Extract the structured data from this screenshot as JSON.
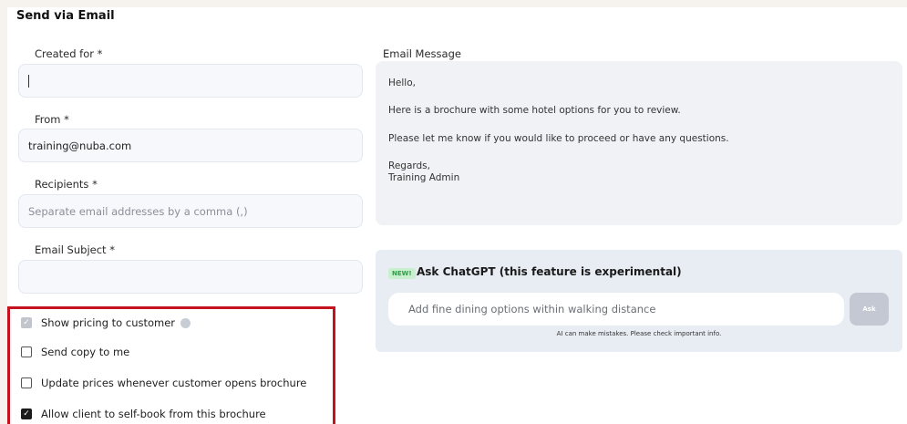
{
  "header": {
    "title": "Send via Email"
  },
  "form": {
    "created_for": {
      "label": "Created for *",
      "value": ""
    },
    "from": {
      "label": "From *",
      "value": "training@nuba.com"
    },
    "recipients": {
      "label": "Recipients *",
      "placeholder": "Separate email addresses by a comma (,)"
    },
    "subject": {
      "label": "Email Subject *",
      "value": ""
    }
  },
  "message": {
    "label": "Email Message",
    "lines": [
      "Hello,",
      "Here is a brochure with some hotel options for you to review.",
      "Please let me know if you would like to proceed or have any questions.",
      "Regards,",
      "Training Admin"
    ]
  },
  "ai": {
    "badge": "NEW!",
    "title": "Ask ChatGPT (this feature is experimental)",
    "input_value": "Add fine dining options within walking distance",
    "ask_label": "Ask",
    "disclaimer": "AI can make mistakes. Please check important info."
  },
  "options": [
    {
      "label": "Show pricing to customer",
      "checked": true,
      "disabled": true,
      "info": true
    },
    {
      "label": "Send copy to me",
      "checked": false
    },
    {
      "label": "Update prices whenever customer opens brochure",
      "checked": false
    },
    {
      "label": "Allow client to self-book from this brochure",
      "checked": true
    }
  ],
  "colors": {
    "highlight_border": "#c5121f",
    "ai_panel_bg": "#e8edf3",
    "new_badge": "#2e9d45"
  }
}
